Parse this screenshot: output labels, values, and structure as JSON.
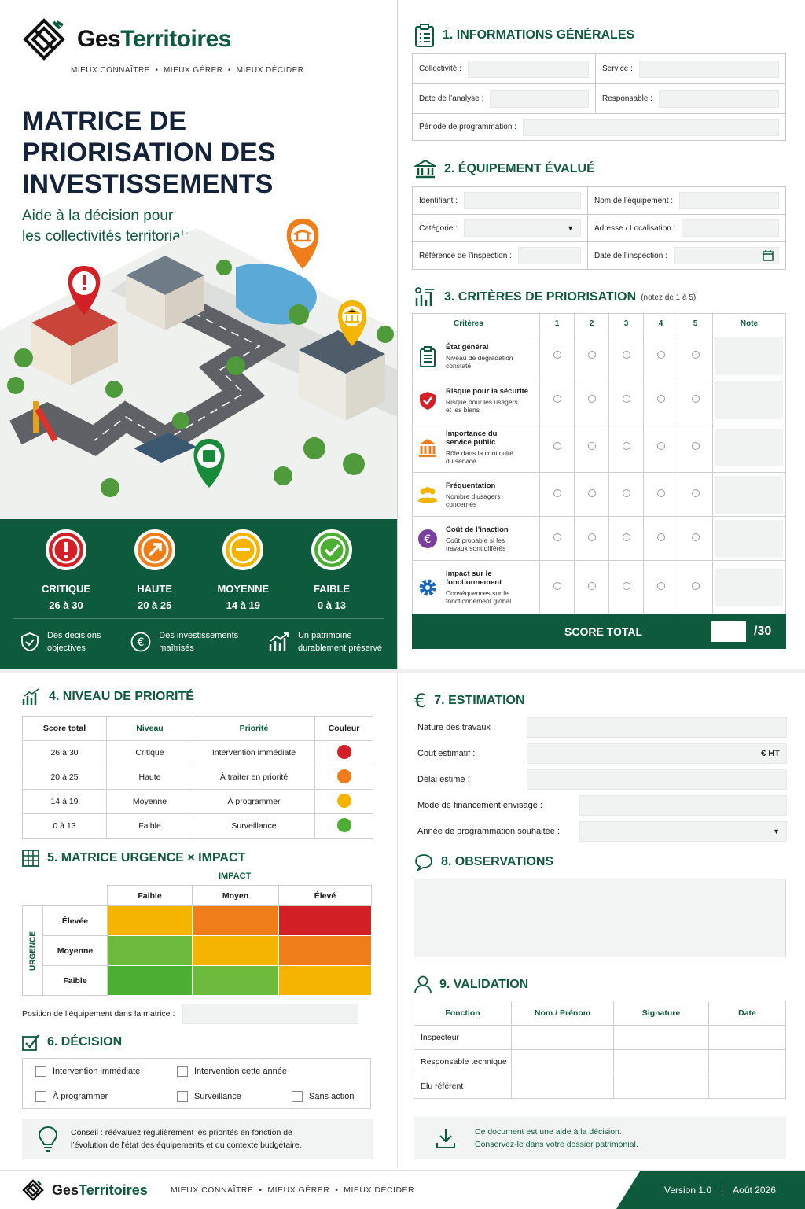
{
  "brand": {
    "name_part1": "Ges",
    "name_part2": "Territoires",
    "tagline": "MIEUX CONNAÎTRE  •  MIEUX GÉRER  •  MIEUX DÉCIDER"
  },
  "cover": {
    "title_line1": "MATRICE DE",
    "title_line2": "PRIORISATION DES",
    "title_line3": "INVESTISSEMENTS",
    "subtitle_line1": "Aide à la décision pour",
    "subtitle_line2": "les collectivités territoriales"
  },
  "levels": [
    {
      "label": "CRITIQUE",
      "range": "26 à 30",
      "color": "#d32027"
    },
    {
      "label": "HAUTE",
      "range": "20 à 25",
      "color": "#ee7d1a"
    },
    {
      "label": "MOYENNE",
      "range": "14 à 19",
      "color": "#f4b400"
    },
    {
      "label": "FAIBLE",
      "range": "0 à 13",
      "color": "#4caf33"
    }
  ],
  "benefits": [
    {
      "line1": "Des décisions",
      "line2": "objectives"
    },
    {
      "line1": "Des investissements",
      "line2": "maîtrisés"
    },
    {
      "line1": "Un patrimoine",
      "line2": "durablement préservé"
    }
  ],
  "s1": {
    "title": "1. INFORMATIONS GÉNÉRALES",
    "collectivite": "Collectivité :",
    "service": "Service :",
    "date_analyse": "Date de l’analyse :",
    "responsable": "Responsable :",
    "periode": "Période de programmation :"
  },
  "s2": {
    "title": "2. ÉQUIPEMENT ÉVALUÉ",
    "identifiant": "Identifiant :",
    "nom": "Nom de l’équipement :",
    "categorie": "Catégorie :",
    "adresse": "Adresse / Localisation :",
    "ref": "Référence de l’inspection :",
    "date": "Date de l’inspection :"
  },
  "s3": {
    "title": "3. CRITÈRES DE PRIORISATION",
    "note_hint": "(notez de 1 à 5)",
    "col_criteres": "Critères",
    "cols": [
      "1",
      "2",
      "3",
      "4",
      "5"
    ],
    "col_note": "Note",
    "criteria": [
      {
        "name": "État général",
        "desc1": "Niveau de dégradation",
        "desc2": "constaté",
        "desc3": "",
        "icon": "clipboard-icon",
        "color": "#0d5a3c"
      },
      {
        "name": "Risque pour la sécurité",
        "desc1": "Risque pour les usagers",
        "desc2": "et les biens",
        "desc3": "",
        "icon": "shield-icon",
        "color": "#d32027"
      },
      {
        "name": "Importance du",
        "name2": "service public",
        "desc1": "Rôle dans la continuité",
        "desc2": "du service",
        "icon": "building-icon",
        "color": "#ee7d1a"
      },
      {
        "name": "Fréquentation",
        "desc1": "Nombre d’usagers",
        "desc2": "concernés",
        "desc3": "",
        "icon": "users-icon",
        "color": "#f4b400"
      },
      {
        "name": "Coût de l’inaction",
        "desc1": "Coût probable si les",
        "desc2": "travaux sont différés",
        "desc3": "",
        "icon": "euro-icon",
        "color": "#7b3fa0"
      },
      {
        "name": "Impact sur le",
        "name2": "fonctionnement",
        "desc1": "Conséquences sur le",
        "desc2": "fonctionnement global",
        "icon": "gear-icon",
        "color": "#1565c0"
      }
    ],
    "total_label": "SCORE TOTAL",
    "total_suffix": "/30"
  },
  "s4": {
    "title": "4. NIVEAU DE PRIORITÉ",
    "headers": [
      "Score total",
      "Niveau",
      "Priorité",
      "Couleur"
    ],
    "rows": [
      {
        "score": "26 à 30",
        "niveau": "Critique",
        "priorite": "Intervention immédiate",
        "color": "#d32027"
      },
      {
        "score": "20 à 25",
        "niveau": "Haute",
        "priorite": "À traiter en priorité",
        "color": "#ee7d1a"
      },
      {
        "score": "14 à 19",
        "niveau": "Moyenne",
        "priorite": "À programmer",
        "color": "#f4b400"
      },
      {
        "score": "0 à 13",
        "niveau": "Faible",
        "priorite": "Surveillance",
        "color": "#4caf33"
      }
    ]
  },
  "s5": {
    "title": "5. MATRICE URGENCE × IMPACT",
    "impact": "IMPACT",
    "urgence": "URGENCE",
    "cols": [
      "Faible",
      "Moyen",
      "Élevé"
    ],
    "rows": [
      {
        "label": "Élevée",
        "colors": [
          "#f4b400",
          "#ee7d1a",
          "#d32027"
        ]
      },
      {
        "label": "Moyenne",
        "colors": [
          "#6cbb3c",
          "#f4b400",
          "#ee7d1a"
        ]
      },
      {
        "label": "Faible",
        "colors": [
          "#4caf33",
          "#6cbb3c",
          "#f4b400"
        ]
      }
    ],
    "position_label": "Position de l’équipement dans la matrice :"
  },
  "s6": {
    "title": "6. DÉCISION",
    "opts": [
      "Intervention immédiate",
      "Intervention cette année",
      "À programmer",
      "Surveillance",
      "Sans action"
    ]
  },
  "tip": {
    "line1": "Conseil : réévaluez régulièrement les priorités en fonction de",
    "line2": "l’évolution de l’état des équipements et du contexte budgétaire."
  },
  "s7": {
    "title": "7. ESTIMATION",
    "nature": "Nature des travaux :",
    "cout": "Coût estimatif :",
    "cout_unit": "€ HT",
    "delai": "Délai estimé :",
    "mode": "Mode de financement envisagé :",
    "annee": "Année de programmation souhaitée :"
  },
  "s8": {
    "title": "8. OBSERVATIONS"
  },
  "s9": {
    "title": "9. VALIDATION",
    "headers": [
      "Fonction",
      "Nom / Prénom",
      "Signature",
      "Date"
    ],
    "rows": [
      "Inspecteur",
      "Responsable technique",
      "Élu référent"
    ]
  },
  "note": {
    "line1": "Ce document est une aide à la décision.",
    "line2": "Conservez-le dans votre dossier patrimonial."
  },
  "footer": {
    "tagline": "MIEUX CONNAÎTRE  •  MIEUX GÉRER  •  MIEUX DÉCIDER",
    "version": "Version 1.0",
    "sep": "|",
    "date": "Août 2026"
  }
}
